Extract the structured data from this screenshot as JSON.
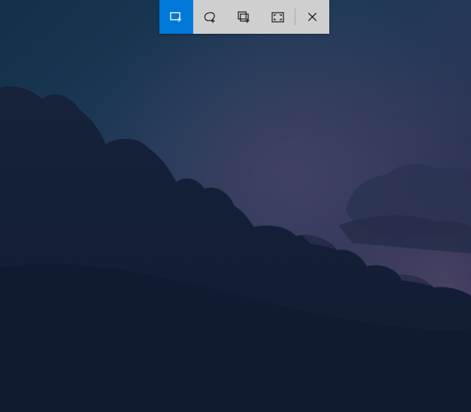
{
  "snip_toolbar": {
    "modes": [
      {
        "name": "rectangular-snip",
        "icon": "rectangle-snip-icon",
        "selected": true
      },
      {
        "name": "freeform-snip",
        "icon": "freeform-snip-icon",
        "selected": false
      },
      {
        "name": "window-snip",
        "icon": "window-snip-icon",
        "selected": false
      },
      {
        "name": "fullscreen-snip",
        "icon": "fullscreen-snip-icon",
        "selected": false
      }
    ],
    "close_icon": "close-icon"
  },
  "colors": {
    "toolbar_bg": "#cfcfcf",
    "active_accent": "#0078d7",
    "icon_dark": "#1f1f1f",
    "icon_on_accent": "#ffffff"
  }
}
